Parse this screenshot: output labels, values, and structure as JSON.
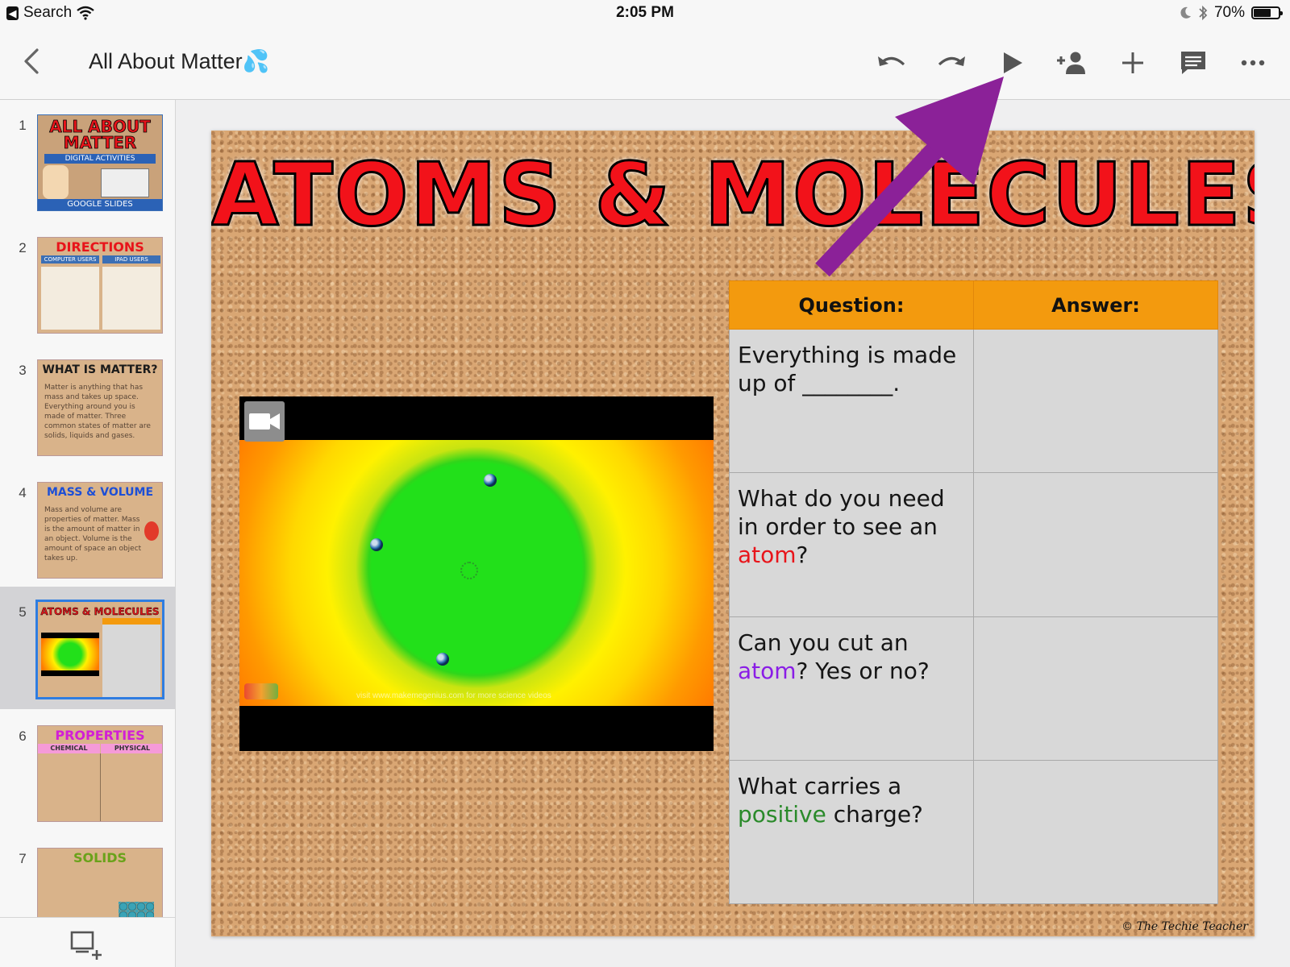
{
  "status_bar": {
    "back_label": "Search",
    "time": "2:05 PM",
    "battery": "70%",
    "battery_level": 0.7
  },
  "toolbar": {
    "doc_title": "All About Matter💦",
    "icons": [
      "back-icon",
      "undo-icon",
      "redo-icon",
      "present-play-icon",
      "add-person-icon",
      "add-icon",
      "comment-icon",
      "more-icon"
    ]
  },
  "slides": [
    {
      "number": "1",
      "title": "ALL ABOUT MATTER",
      "subtitle": "DIGITAL ACTIVITIES",
      "footer": "GOOGLE SLIDES",
      "title_color": "#e8141a"
    },
    {
      "number": "2",
      "title": "DIRECTIONS",
      "col1": "COMPUTER USERS",
      "col2": "IPAD USERS",
      "title_color": "#e8141a"
    },
    {
      "number": "3",
      "title": "WHAT IS MATTER?",
      "body": "Matter is anything that has mass and takes up space. Everything around you is made of matter. Three common states of matter are solids, liquids and gases.",
      "title_color": "#1b1b1b"
    },
    {
      "number": "4",
      "title": "MASS & VOLUME",
      "body": "Mass and volume are properties of matter. Mass is the amount of matter in an object. Volume is the amount of space an object takes up.",
      "title_color": "#1d4fd6"
    },
    {
      "number": "5",
      "title": "ATOMS & MOLECULES",
      "title_color": "#e8141a",
      "selected": true
    },
    {
      "number": "6",
      "title": "PROPERTIES",
      "col1": "CHEMICAL",
      "col2": "PHYSICAL",
      "title_color": "#d21fd6"
    },
    {
      "number": "7",
      "title": "SOLIDS",
      "title_color": "#6aa21a"
    }
  ],
  "slide": {
    "title": "ATOMS & MOLECULES",
    "table": {
      "headers": [
        "Question:",
        "Answer:"
      ],
      "rows": [
        {
          "q_pre": "Everything is made up of ________.",
          "highlight": "",
          "q_post": "",
          "answer": ""
        },
        {
          "q_pre": "What do you need in order to see an ",
          "highlight": "atom",
          "q_post": "?",
          "answer": ""
        },
        {
          "q_pre": "Can you cut an ",
          "highlight": "atom",
          "q_post": "? Yes or no?",
          "answer": ""
        },
        {
          "q_pre": "What carries a ",
          "highlight": "positive",
          "q_post": " charge?",
          "answer": ""
        }
      ]
    },
    "video_caption": "visit www.makemegenius.com for more science videos",
    "credit": "© The Techie Teacher"
  },
  "colors": {
    "accent_blue": "#2f7de1",
    "arrow_purple": "#8b2198",
    "header_orange": "#f39a0e",
    "title_red": "#f2121a"
  }
}
